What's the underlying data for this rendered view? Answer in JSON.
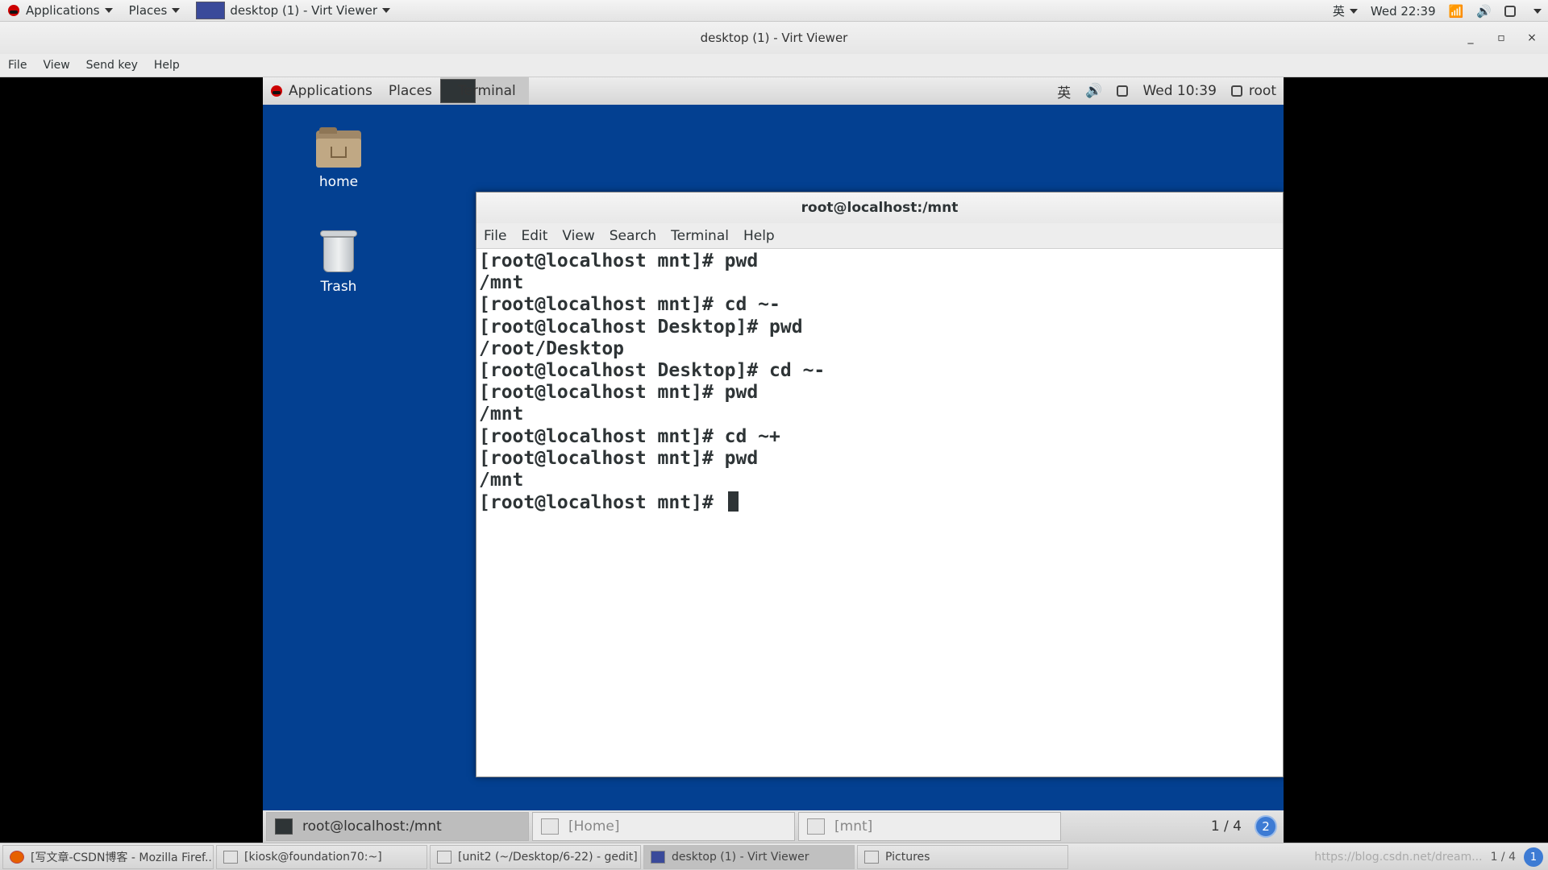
{
  "host_top": {
    "applications": "Applications",
    "places": "Places",
    "active_window": "desktop (1) - Virt Viewer",
    "ime": "英",
    "clock": "Wed 22:39"
  },
  "viewer": {
    "title": "desktop (1) - Virt Viewer",
    "minimize": "_",
    "maximize": "▫",
    "close": "×",
    "menu": [
      "File",
      "View",
      "Send key",
      "Help"
    ]
  },
  "guest_top": {
    "applications": "Applications",
    "places": "Places",
    "terminal_task": "Terminal",
    "ime": "英",
    "clock": "Wed 10:39",
    "user": "root"
  },
  "desktop_icons": {
    "home": "home",
    "trash": "Trash"
  },
  "terminal": {
    "title": "root@localhost:/mnt",
    "menu": [
      "File",
      "Edit",
      "View",
      "Search",
      "Terminal",
      "Help"
    ],
    "lines": [
      "[root@localhost mnt]# pwd",
      "/mnt",
      "[root@localhost mnt]# cd ~-",
      "[root@localhost Desktop]# pwd",
      "/root/Desktop",
      "[root@localhost Desktop]# cd ~-",
      "[root@localhost mnt]# pwd",
      "/mnt",
      "[root@localhost mnt]# cd ~+",
      "[root@localhost mnt]# pwd",
      "/mnt"
    ],
    "prompt": "[root@localhost mnt]# "
  },
  "guest_bottom": {
    "tasks": [
      "root@localhost:/mnt",
      "[Home]",
      "[mnt]"
    ],
    "workspace": "1 / 4",
    "badge": "2"
  },
  "host_bottom": {
    "tasks": [
      "[写文章-CSDN博客 - Mozilla Firef...",
      "[kiosk@foundation70:~]",
      "[unit2 (~/Desktop/6-22) - gedit]",
      "desktop (1) - Virt Viewer",
      "Pictures"
    ],
    "watermark": "https://blog.csdn.net/dream...",
    "workspace": "1 / 4",
    "badge": "1"
  },
  "colors": {
    "guest_desktop": "#034091",
    "terminal_text": "#2e3436",
    "badge_blue": "#3d7bd4"
  }
}
